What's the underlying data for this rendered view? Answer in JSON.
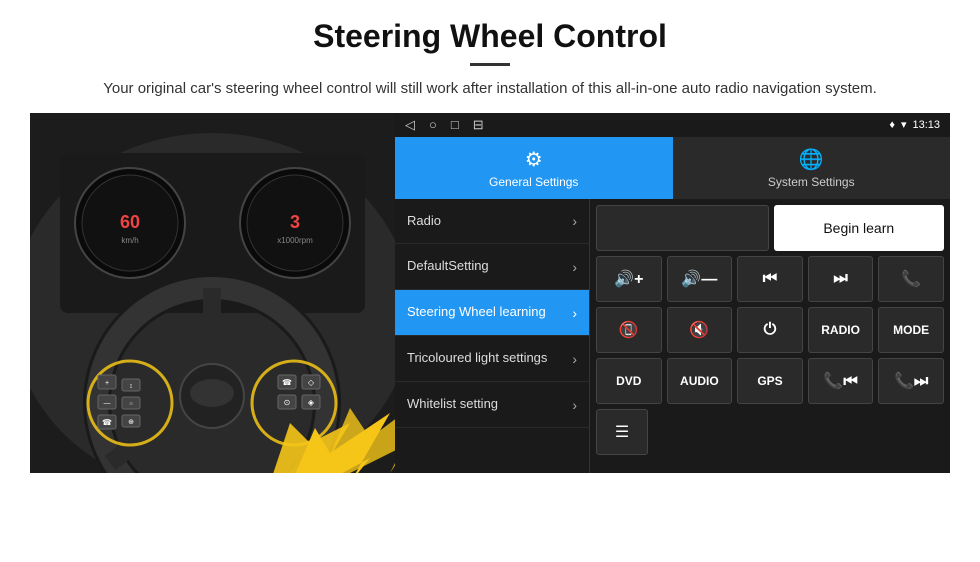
{
  "header": {
    "title": "Steering Wheel Control",
    "subtitle": "Your original car's steering wheel control will still work after installation of this all-in-one auto radio navigation system."
  },
  "statusBar": {
    "time": "13:13",
    "navIcons": [
      "◁",
      "○",
      "□",
      "⊟"
    ],
    "rightIcons": [
      "♦",
      "▾",
      "📶"
    ]
  },
  "tabs": {
    "general": {
      "label": "General Settings",
      "icon": "⚙"
    },
    "system": {
      "label": "System Settings",
      "icon": "🌐"
    }
  },
  "menu": {
    "items": [
      {
        "label": "Radio",
        "active": false
      },
      {
        "label": "DefaultSetting",
        "active": false
      },
      {
        "label": "Steering Wheel learning",
        "active": true
      },
      {
        "label": "Tricoloured light settings",
        "active": false
      },
      {
        "label": "Whitelist setting",
        "active": false
      }
    ]
  },
  "controls": {
    "beginLearn": "Begin learn",
    "row1": [
      "🔊+",
      "🔊—",
      "⏮",
      "⏭",
      "📞"
    ],
    "row2": [
      "📞",
      "🔊×",
      "⏻",
      "RADIO",
      "MODE"
    ],
    "row3": [
      "DVD",
      "AUDIO",
      "GPS",
      "📞⏮",
      "📞⏭"
    ],
    "whitelistIcon": "☰"
  }
}
